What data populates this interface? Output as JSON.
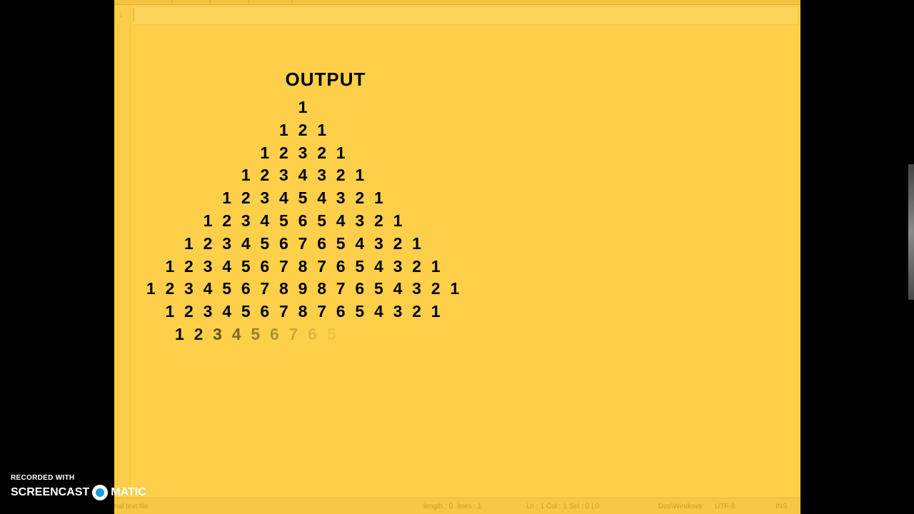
{
  "editor": {
    "line_number": "1",
    "output_title": "OUTPUT",
    "pyramid_rows": [
      {
        "digits": [
          "1"
        ]
      },
      {
        "digits": [
          "1",
          "2",
          "1"
        ]
      },
      {
        "digits": [
          "1",
          "2",
          "3",
          "2",
          "1"
        ]
      },
      {
        "digits": [
          "1",
          "2",
          "3",
          "4",
          "3",
          "2",
          "1"
        ]
      },
      {
        "digits": [
          "1",
          "2",
          "3",
          "4",
          "5",
          "4",
          "3",
          "2",
          "1"
        ]
      },
      {
        "digits": [
          "1",
          "2",
          "3",
          "4",
          "5",
          "6",
          "5",
          "4",
          "3",
          "2",
          "1"
        ]
      },
      {
        "digits": [
          "1",
          "2",
          "3",
          "4",
          "5",
          "6",
          "7",
          "6",
          "5",
          "4",
          "3",
          "2",
          "1"
        ]
      },
      {
        "digits": [
          "1",
          "2",
          "3",
          "4",
          "5",
          "6",
          "7",
          "8",
          "7",
          "6",
          "5",
          "4",
          "3",
          "2",
          "1"
        ]
      },
      {
        "digits": [
          "1",
          "2",
          "3",
          "4",
          "5",
          "6",
          "7",
          "8",
          "9",
          "8",
          "7",
          "6",
          "5",
          "4",
          "3",
          "2",
          "1"
        ]
      },
      {
        "digits": [
          "1",
          "2",
          "3",
          "4",
          "5",
          "6",
          "7",
          "8",
          "7",
          "6",
          "5",
          "4",
          "3",
          "2",
          "1"
        ]
      },
      {
        "digits": [
          "1",
          "2",
          "3",
          "4",
          "5",
          "6",
          "7",
          "6",
          "5"
        ],
        "partial": true,
        "fade": [
          1,
          0.85,
          0.6,
          0.5,
          0.4,
          0.3,
          0.2,
          0.12,
          0.06
        ]
      }
    ]
  },
  "status_bar": {
    "file_type": "nal text file",
    "length": "length : 0",
    "lines": "lines : 1",
    "ln": "Ln : 1",
    "col": "Col : 1",
    "sel": "Sel : 0 | 0",
    "eol": "Dos\\Windows",
    "encoding": "UTF-8",
    "mode": "INS"
  },
  "watermark": {
    "recorded_with": "RECORDED WITH",
    "brand_left": "SCREENCAST",
    "brand_right": "MATIC"
  },
  "colors": {
    "editor_background": "#fed04a",
    "text": "#000000"
  }
}
